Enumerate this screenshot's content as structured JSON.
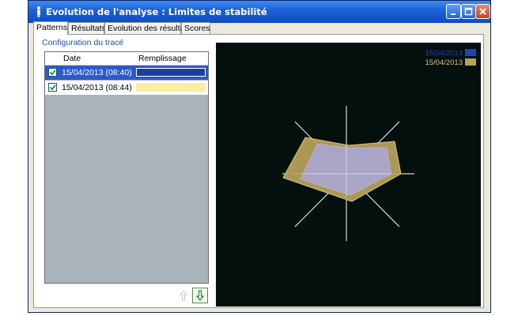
{
  "window": {
    "title": "Evolution de l'analyse : Limites de stabilité"
  },
  "tabs": [
    {
      "label": "Patterns",
      "active": true
    },
    {
      "label": "Résultats",
      "active": false
    },
    {
      "label": "Evolution des résultats",
      "active": false
    },
    {
      "label": "Scores",
      "active": false
    }
  ],
  "config": {
    "title": "Configuration du tracé",
    "columns": {
      "date": "Date",
      "fill": "Remplissage"
    },
    "rows": [
      {
        "date": "15/04/2013 (08:40)",
        "checked": true,
        "selected": true,
        "fill_color": "#1e3f99"
      },
      {
        "date": "15/04/2013 (08:44)",
        "checked": true,
        "selected": false,
        "fill_color": "#f7eea0"
      }
    ]
  },
  "legend": [
    {
      "label": "15/04/2013",
      "color": "#1c46b8"
    },
    {
      "label": "15/04/2013",
      "color": "#b8a258"
    }
  ],
  "colors": {
    "radar_bg": "#04100e",
    "axes": "#ffffff",
    "poly_back": "#b8a25a",
    "poly_front": "#aaa6d6"
  },
  "icons": {
    "up": "arrow-up-icon",
    "down": "arrow-down-icon"
  }
}
